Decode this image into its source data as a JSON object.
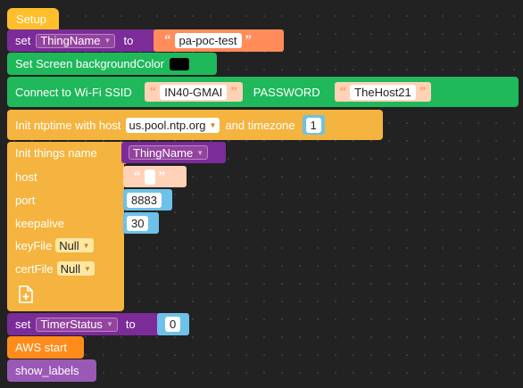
{
  "colors": {
    "purple": "#7b2c98",
    "orange": "#ff8c5a",
    "green": "#1fb85b",
    "yellow": "#f4b43f",
    "blue_val": "#6ec1e8",
    "setup_yellow": "#ffbf2b"
  },
  "blocks": {
    "setup": {
      "label": "Setup"
    },
    "set_thing": {
      "set": "set",
      "var": "ThingName",
      "to": "to",
      "value": "pa-poc-test",
      "dropdown_icon": "chevron-down-icon"
    },
    "screen_bg": {
      "label": "Set Screen backgroundColor",
      "color": "#000000"
    },
    "wifi": {
      "label": "Connect to Wi-Fi SSID",
      "ssid": "IN40-GMAI",
      "password_label": "PASSWORD",
      "password": "TheHost21"
    },
    "ntp": {
      "label": "Init ntptime with host",
      "host": "us.pool.ntp.org",
      "tz_label": "and timezone",
      "timezone": "1"
    },
    "things": {
      "label": "Init things name",
      "name": "ThingName",
      "host_label": "host",
      "host_value": "",
      "port_label": "port",
      "port": "8883",
      "keepalive_label": "keepalive",
      "keepalive": "30",
      "keyfile_label": "keyFile",
      "keyfile": "Null",
      "certfile_label": "certFile",
      "certfile": "Null",
      "add_icon": "plus-page-icon"
    },
    "timer": {
      "set": "set",
      "var": "TimerStatus",
      "to": "to",
      "value": "0"
    },
    "aws": {
      "label": "AWS start"
    },
    "labels": {
      "label": "show_labels"
    }
  }
}
